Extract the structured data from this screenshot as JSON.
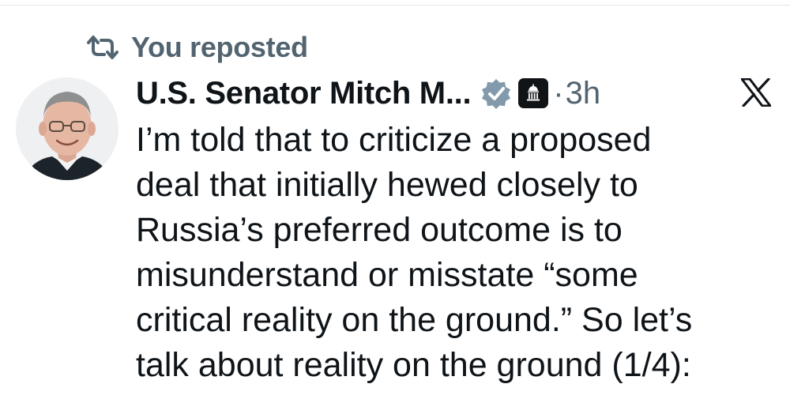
{
  "repost": {
    "icon": "repost-icon",
    "label": "You reposted"
  },
  "post": {
    "author": {
      "avatar": "avatar",
      "name": "U.S. Senator Mitch M...",
      "verified_icon": "verified-badge-icon",
      "verified_color": "#829aab",
      "affiliation_icon": "government-building-icon"
    },
    "separator": "·",
    "timestamp": "3h",
    "platform_icon": "x-logo-icon",
    "text_lines": [
      "I’m told that to criticize a proposed",
      "deal that initially hewed closely to",
      "Russia’s preferred outcome is to",
      "misunderstand or misstate “some",
      "critical reality on the ground.” So let’s",
      "talk about reality on the ground (1/4):"
    ]
  },
  "colors": {
    "text_primary": "#0f1419",
    "text_secondary": "#536471",
    "background": "#ffffff"
  }
}
